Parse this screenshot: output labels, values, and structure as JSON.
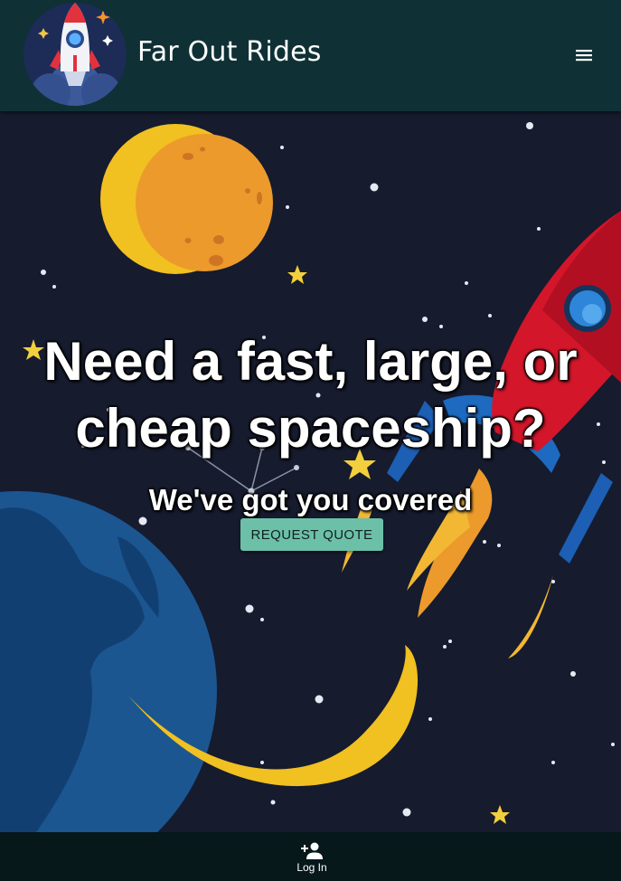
{
  "app_bar": {
    "title": "Far Out Rides",
    "logo_icon": "rocket-logo-icon",
    "menu_icon": "hamburger-menu-icon"
  },
  "hero": {
    "headline": "Need a fast, large, or cheap spaceship?",
    "subheadline": "We've got you covered",
    "cta_label": "REQUEST QUOTE"
  },
  "bottom_nav": {
    "items": [
      {
        "label": "Log In",
        "icon": "person-add-icon"
      }
    ]
  },
  "colors": {
    "app_bar": "#0f3135",
    "background": "#161b2e",
    "cta": "#6cc0a8",
    "bottom_nav": "#06181a"
  }
}
